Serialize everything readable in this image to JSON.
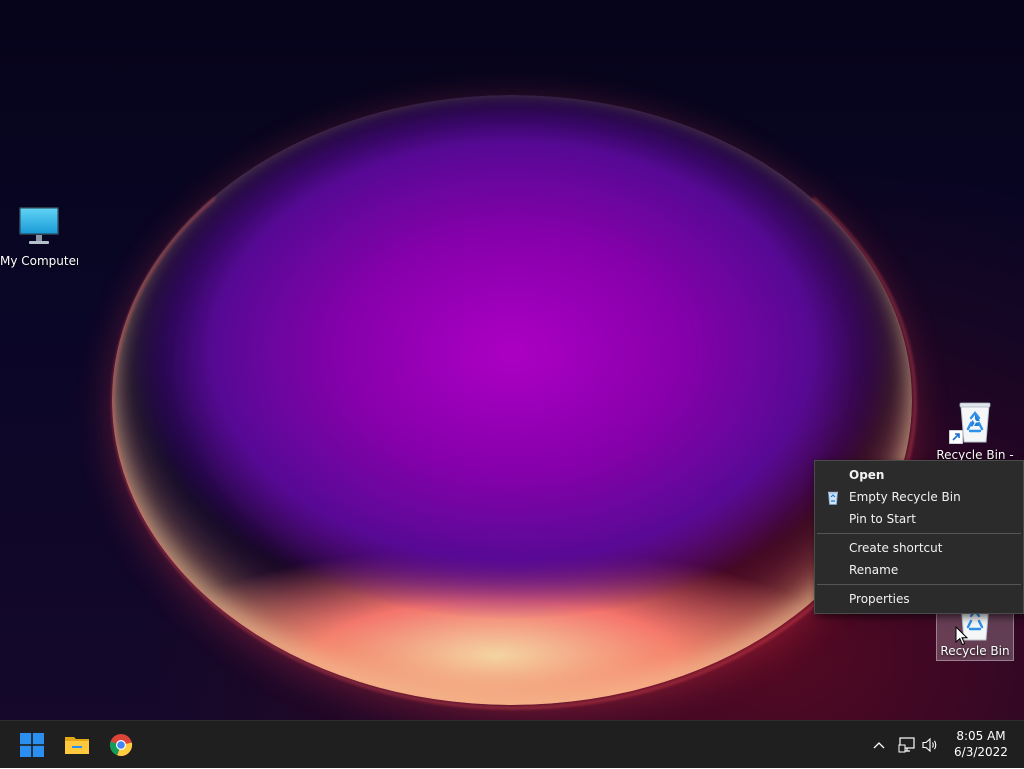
{
  "desktop": {
    "icons": [
      {
        "label": "My Computer",
        "icon": "monitor-icon"
      },
      {
        "label": "Recycle Bin -",
        "icon": "recycle-bin-icon",
        "shortcut": true
      },
      {
        "label": "Recycle Bin",
        "icon": "recycle-bin-icon",
        "selected": true
      }
    ]
  },
  "context_menu": {
    "items": [
      {
        "label": "Open",
        "bold": true
      },
      {
        "label": "Empty Recycle Bin",
        "icon": "recycle-bin-icon"
      },
      {
        "label": "Pin to Start"
      },
      {
        "label": "Create shortcut"
      },
      {
        "label": "Rename"
      },
      {
        "label": "Properties"
      }
    ]
  },
  "taskbar": {
    "pinned": [
      {
        "name": "Start",
        "icon": "windows-logo-icon"
      },
      {
        "name": "File Explorer",
        "icon": "folder-icon"
      },
      {
        "name": "Google Chrome",
        "icon": "chrome-icon"
      }
    ],
    "tray": {
      "icons": [
        "chevron-up-icon",
        "network-icon",
        "volume-icon"
      ],
      "time": "8:05 AM",
      "date": "6/3/2022"
    }
  },
  "colors": {
    "taskbar_bg": "#1f1f1f",
    "menu_bg": "#2b2b2b",
    "windows_blue": "#2b8ff0"
  }
}
